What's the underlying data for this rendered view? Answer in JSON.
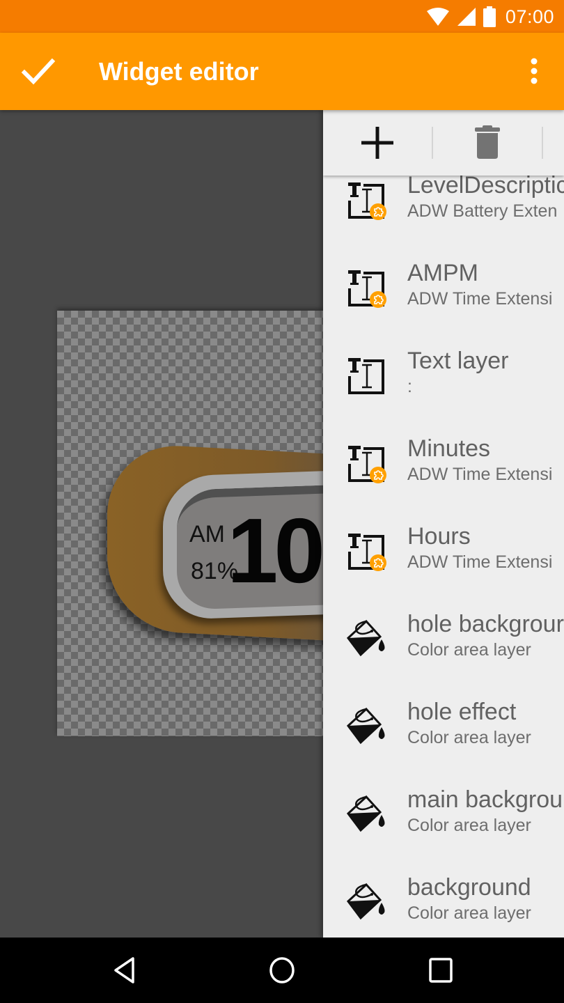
{
  "status_bar": {
    "time": "07:00",
    "icons": [
      "wifi-icon",
      "cellular-signal-icon",
      "battery-icon"
    ]
  },
  "app_bar": {
    "confirm_icon": "check-icon",
    "title": "Widget editor",
    "overflow_icon": "more-vert-icon",
    "background_color": "#ff9800",
    "status_color": "#f57c00"
  },
  "canvas": {
    "widget_preview": {
      "ampm": "AM",
      "battery_level": "81%",
      "hours": "10"
    }
  },
  "layers_panel": {
    "toolbar": {
      "add_icon": "add-icon",
      "delete_icon": "delete-icon"
    },
    "layers": [
      {
        "name": "LevelDescriptic",
        "subtitle": "ADW Battery Exten",
        "icon": "text-extension-icon"
      },
      {
        "name": "AMPM",
        "subtitle": "ADW Time Extensi",
        "icon": "text-extension-icon"
      },
      {
        "name": "Text layer",
        "subtitle": ":",
        "icon": "text-layer-icon"
      },
      {
        "name": "Minutes",
        "subtitle": "ADW Time Extensi",
        "icon": "text-extension-icon"
      },
      {
        "name": "Hours",
        "subtitle": "ADW Time Extensi",
        "icon": "text-extension-icon"
      },
      {
        "name": "hole backgrour",
        "subtitle": "Color area layer",
        "icon": "paint-bucket-icon"
      },
      {
        "name": "hole effect",
        "subtitle": "Color area layer",
        "icon": "paint-bucket-icon"
      },
      {
        "name": "main backgrou",
        "subtitle": "Color area layer",
        "icon": "paint-bucket-icon"
      },
      {
        "name": "background",
        "subtitle": "Color area layer",
        "icon": "paint-bucket-icon"
      }
    ]
  },
  "nav_bar": {
    "buttons": [
      "back-icon",
      "home-icon",
      "recents-icon"
    ]
  }
}
